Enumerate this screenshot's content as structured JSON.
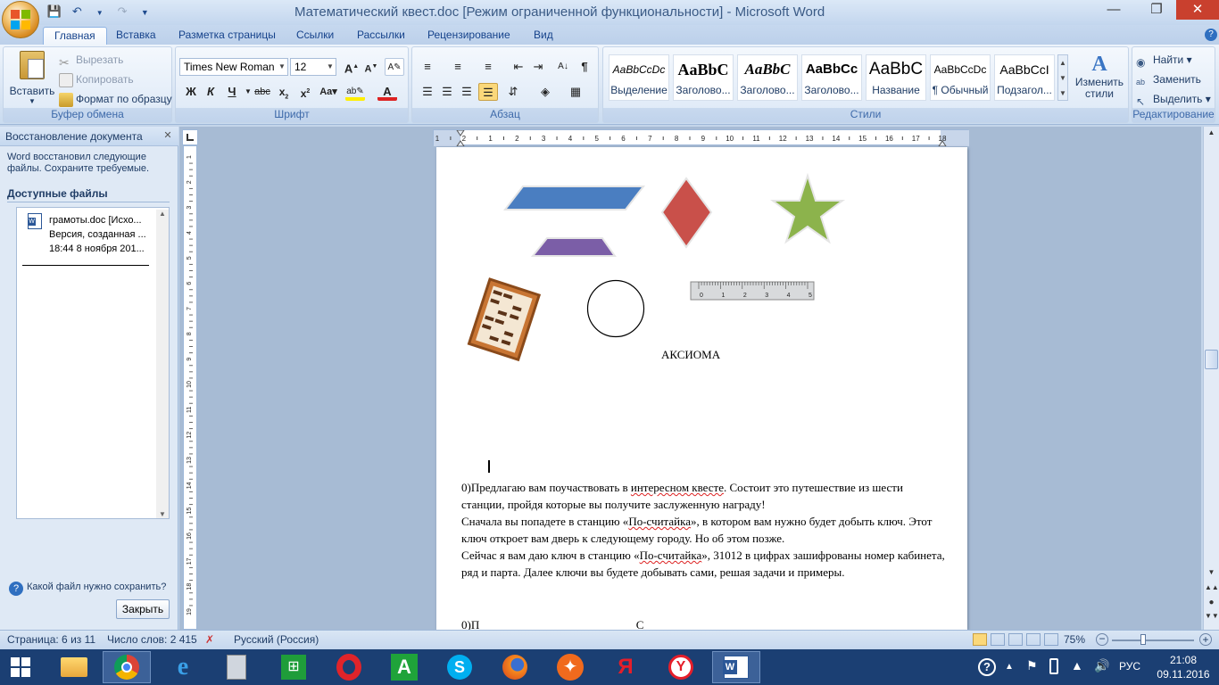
{
  "window": {
    "title": "Математический квест.doc [Режим ограниченной функциональности] - Microsoft Word"
  },
  "qat": {
    "save_icon": "save-icon",
    "undo_icon": "undo-icon",
    "redo_icon": "redo-icon"
  },
  "tabs": [
    "Главная",
    "Вставка",
    "Разметка страницы",
    "Ссылки",
    "Рассылки",
    "Рецензирование",
    "Вид"
  ],
  "ribbon": {
    "clipboard": {
      "label": "Буфер обмена",
      "paste": "Вставить",
      "cut": "Вырезать",
      "copy": "Копировать",
      "format_painter": "Формат по образцу"
    },
    "font": {
      "label": "Шрифт",
      "family": "Times New Roman",
      "size": "12"
    },
    "paragraph": {
      "label": "Абзац"
    },
    "styles": {
      "label": "Стили",
      "items": [
        {
          "preview": "AaBbCcDc",
          "name": "Выделение"
        },
        {
          "preview": "AaBbC",
          "name": "Заголово..."
        },
        {
          "preview": "AaBbC",
          "name": "Заголово..."
        },
        {
          "preview": "AaBbCc",
          "name": "Заголово..."
        },
        {
          "preview": "AaBbC",
          "name": "Название"
        },
        {
          "preview": "AaBbCcDc",
          "name": "¶ Обычный"
        },
        {
          "preview": "AaBbCcI",
          "name": "Подзагол..."
        }
      ],
      "change_styles": "Изменить стили"
    },
    "editing": {
      "label": "Редактирование",
      "find": "Найти",
      "replace": "Заменить",
      "select": "Выделить"
    }
  },
  "recovery_pane": {
    "title": "Восстановление документа",
    "message": "Word восстановил следующие файлы.  Сохраните требуемые.",
    "available_heading": "Доступные файлы",
    "file": {
      "name": "грамоты.doc  [Исхо...",
      "line2": "Версия, созданная ...",
      "line3": "18:44 8 ноября 201..."
    },
    "help_link": "Какой файл нужно сохранить?",
    "close_button": "Закрыть"
  },
  "hruler": {
    "ticks": [
      "1",
      "2",
      "1",
      "2",
      "3",
      "4",
      "5",
      "6",
      "7",
      "8",
      "9",
      "10",
      "11",
      "12",
      "13",
      "14",
      "15",
      "16",
      "17",
      "18"
    ]
  },
  "vruler": {
    "ticks": [
      "1",
      "2",
      "3",
      "4",
      "5",
      "6",
      "7",
      "8",
      "9",
      "10",
      "11",
      "12",
      "13",
      "14",
      "15",
      "16",
      "17",
      "18",
      "19"
    ]
  },
  "document": {
    "ruler_image_labels": [
      "0",
      "1",
      "2",
      "3",
      "4",
      "5"
    ],
    "axiom_label": "АКСИОМА",
    "para1_a": "0)Предлагаю вам поучаствовать в ",
    "para1_b": "интересном квесте",
    "para1_c": ". Состоит это путешествие из шести станции, пройдя которые вы получите заслуженную награду!",
    "para2_a": "Сначала вы попадете в станцию «",
    "para2_b": "По-считайка",
    "para2_c": "», в котором вам нужно будет добыть ключ. Этот ключ откроет вам дверь к следующему городу. Но об этом позже.",
    "para3_a": "Сейчас я вам даю ключ в станцию «",
    "para3_b": "По-считайка",
    "para3_c": "»,  31012  в цифрах зашифрованы номер кабинета, ряд и парта. Далее ключи вы будете добывать сами, решая задачи и примеры.",
    "para4": "0)П                                                      С"
  },
  "statusbar": {
    "page": "Страница: 6 из 11",
    "words": "Число слов: 2 415",
    "language": "Русский (Россия)",
    "zoom": "75%"
  },
  "taskbar": {
    "items": [
      "start-icon",
      "file-explorer-icon",
      "chrome-icon",
      "ie-icon",
      "calculator-icon",
      "excel-store-icon",
      "opera-icon",
      "aimp-icon",
      "skype-icon",
      "firefox-icon",
      "origin-icon",
      "yandex-icon",
      "yandex-browser-icon",
      "word-icon"
    ],
    "lang": "РУС",
    "time": "21:08",
    "date": "09.11.2016"
  },
  "colors": {
    "accent": "#15428b",
    "parallelogram": "#4a7ec1",
    "diamond": "#c9504a",
    "star": "#8cb34c",
    "trapezoid": "#7b5ea7"
  }
}
